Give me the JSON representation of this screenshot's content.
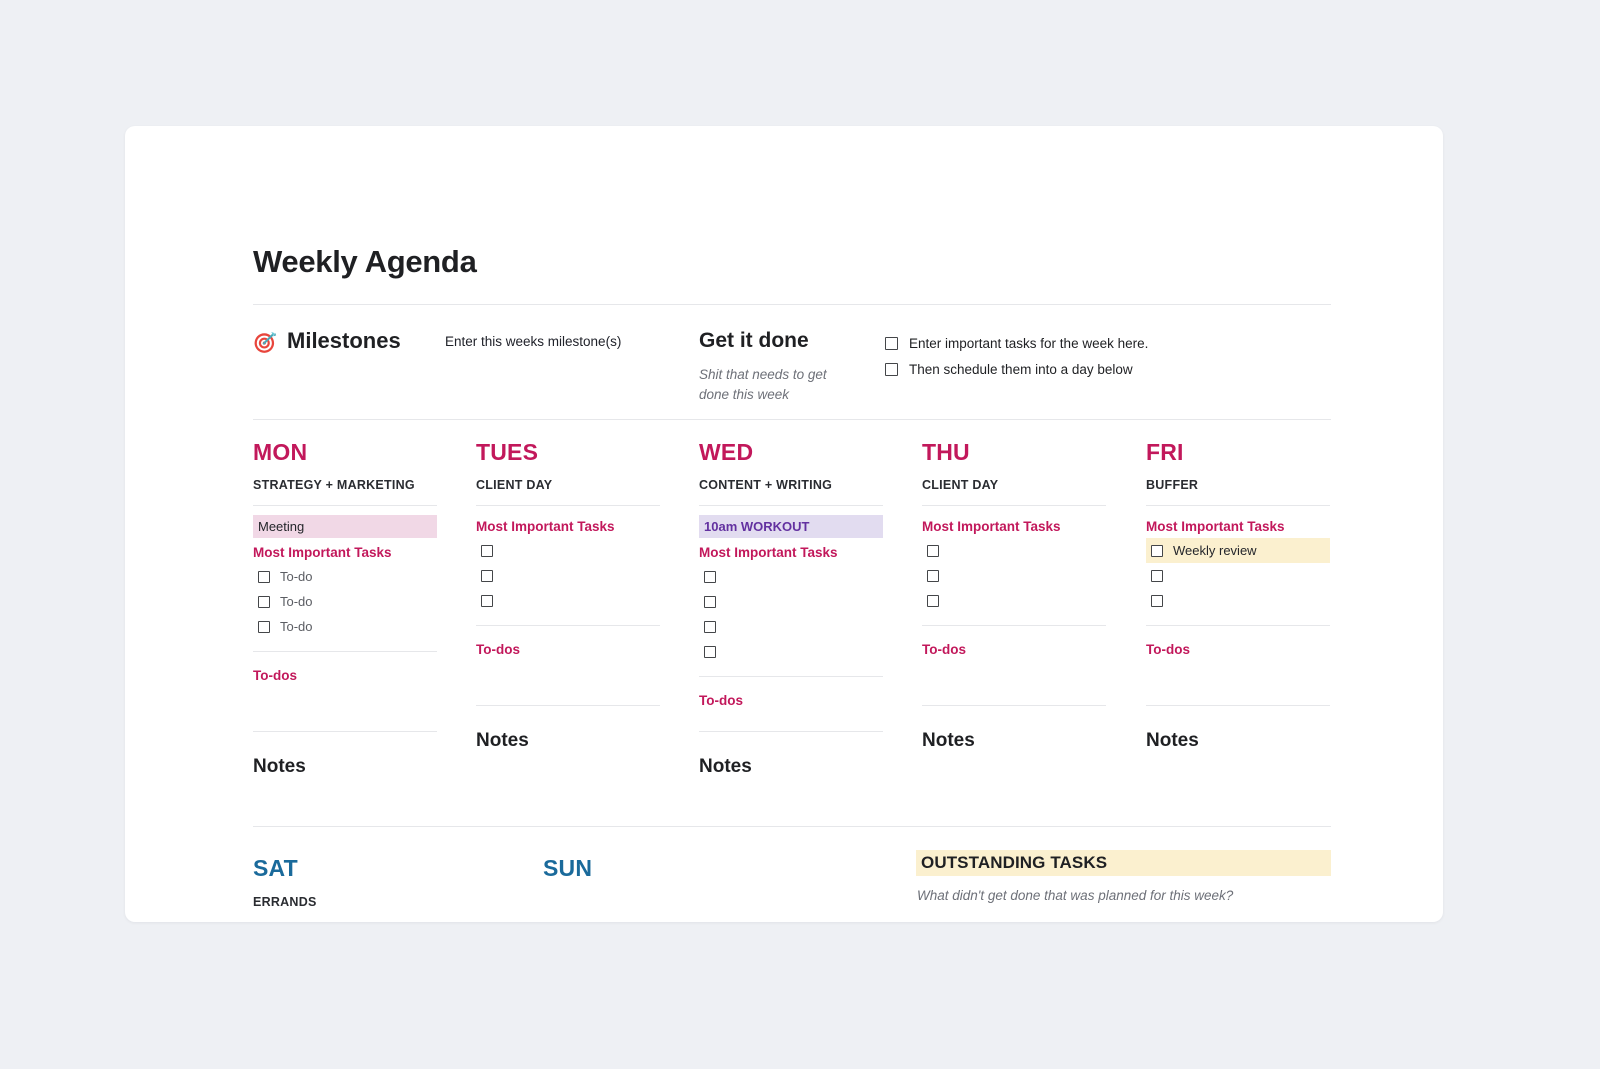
{
  "page_title": "Weekly Agenda",
  "header": {
    "milestones": {
      "icon": "target-icon",
      "label": "Milestones",
      "hint": "Enter this weeks milestone(s)"
    },
    "get_it_done": {
      "title": "Get it done",
      "subtitle": "Shit that needs to get done this week",
      "checklist": [
        {
          "label": "Enter important tasks for the week here.",
          "checked": false
        },
        {
          "label": "Then schedule them into a day below",
          "checked": false
        }
      ]
    }
  },
  "labels": {
    "most_important_tasks": "Most Important Tasks",
    "todos": "To-dos",
    "notes": "Notes"
  },
  "colors": {
    "weekday_accent": "#c2185b",
    "weekend_accent": "#1a6a9b",
    "pink_highlight": "#f1d8e6",
    "purple_highlight": "#e2dcf0",
    "purple_text": "#6331a0",
    "cream_highlight": "#fbf0cf",
    "rule": "#e6e7ea",
    "page_bg": "#eef0f4",
    "card_bg": "#ffffff"
  },
  "days": [
    {
      "name": "MON",
      "theme": "STRATEGY + MARKETING",
      "schedule": {
        "text": "Meeting",
        "style": "pink"
      },
      "tasks": [
        {
          "text": "To-do",
          "checked": false,
          "highlight": false
        },
        {
          "text": "To-do",
          "checked": false,
          "highlight": false
        },
        {
          "text": "To-do",
          "checked": false,
          "highlight": false
        }
      ]
    },
    {
      "name": "TUES",
      "theme": "CLIENT DAY",
      "schedule": {
        "text": "",
        "style": "blank"
      },
      "tasks": [
        {
          "text": "",
          "checked": false,
          "highlight": false
        },
        {
          "text": "",
          "checked": false,
          "highlight": false
        },
        {
          "text": "",
          "checked": false,
          "highlight": false
        }
      ]
    },
    {
      "name": "WED",
      "theme": "CONTENT + WRITING",
      "schedule": {
        "text": "10am WORKOUT",
        "style": "purple"
      },
      "tasks": [
        {
          "text": "",
          "checked": false,
          "highlight": false
        },
        {
          "text": "",
          "checked": false,
          "highlight": false
        },
        {
          "text": "",
          "checked": false,
          "highlight": false
        },
        {
          "text": "",
          "checked": false,
          "highlight": false
        }
      ]
    },
    {
      "name": "THU",
      "theme": "CLIENT DAY",
      "schedule": {
        "text": "",
        "style": "blank"
      },
      "tasks": [
        {
          "text": "",
          "checked": false,
          "highlight": false
        },
        {
          "text": "",
          "checked": false,
          "highlight": false
        },
        {
          "text": "",
          "checked": false,
          "highlight": false
        }
      ]
    },
    {
      "name": "FRI",
      "theme": "BUFFER",
      "schedule": {
        "text": "",
        "style": "blank"
      },
      "tasks": [
        {
          "text": "Weekly review",
          "checked": false,
          "highlight": true
        },
        {
          "text": "",
          "checked": false,
          "highlight": false
        },
        {
          "text": "",
          "checked": false,
          "highlight": false
        }
      ]
    }
  ],
  "weekend": [
    {
      "name": "SAT",
      "theme": "ERRANDS"
    },
    {
      "name": "SUN",
      "theme": ""
    }
  ],
  "outstanding": {
    "title": "OUTSTANDING TASKS",
    "subtitle": "What didn't get done that was planned for this week?"
  }
}
